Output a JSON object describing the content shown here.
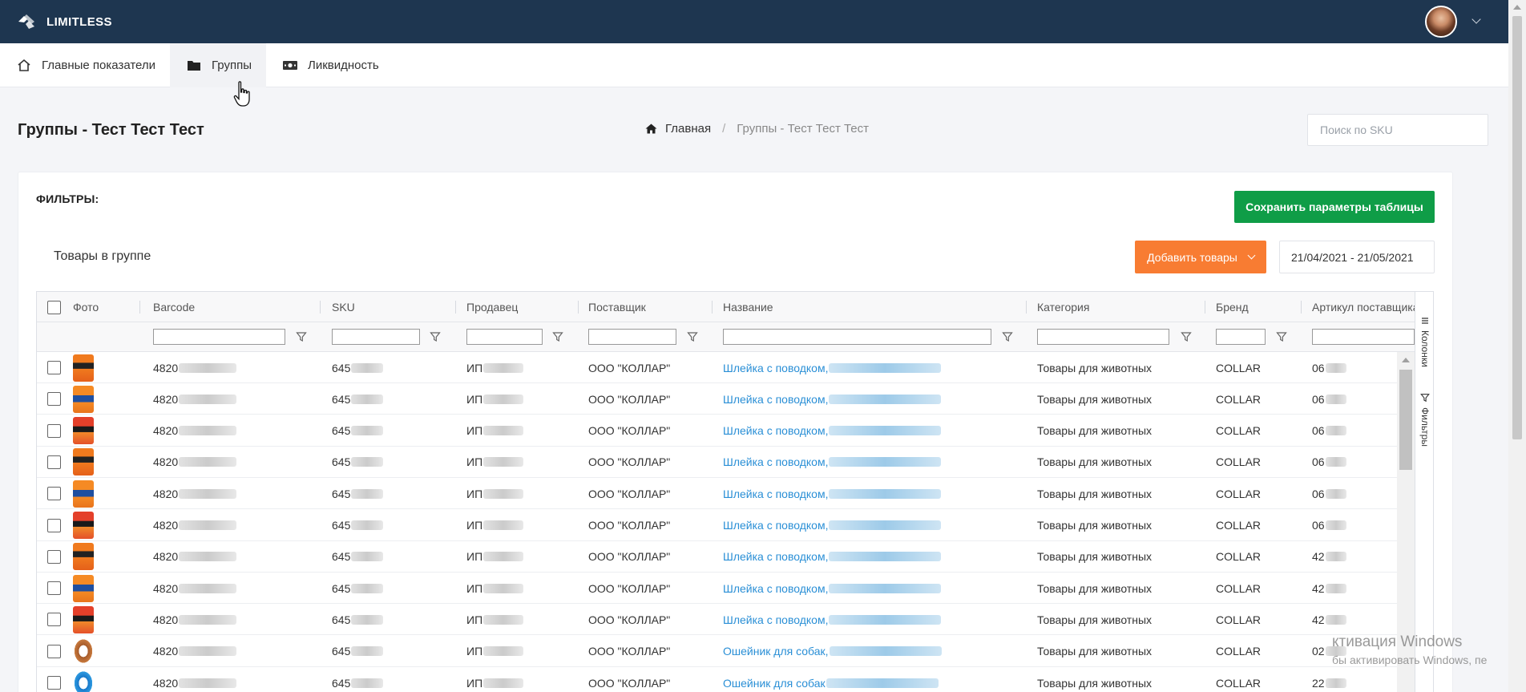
{
  "app": {
    "brand": "LIMITLESS"
  },
  "nav": {
    "items": [
      {
        "label": "Главные показатели",
        "icon": "home-icon"
      },
      {
        "label": "Группы",
        "icon": "folder-icon"
      },
      {
        "label": "Ликвидность",
        "icon": "money-icon"
      }
    ],
    "active": "Группы"
  },
  "page": {
    "title": "Группы - Тест Тест Тест"
  },
  "breadcrumb": {
    "home": "Главная",
    "separator": "/",
    "current": "Группы - Тест Тест Тест"
  },
  "search": {
    "placeholder": "Поиск по SKU",
    "value": ""
  },
  "filters": {
    "label": "ФИЛЬТРЫ:"
  },
  "buttons": {
    "save": "Сохранить параметры таблицы",
    "add": "Добавить товары"
  },
  "group": {
    "label": "Товары в группе"
  },
  "date_range": {
    "value": "21/04/2021 - 21/05/2021"
  },
  "table": {
    "columns": [
      "Фото",
      "Barcode",
      "SKU",
      "Продавец",
      "Поставщик",
      "Название",
      "Категория",
      "Бренд",
      "Артикул поставщика"
    ],
    "side_tabs": [
      "Колонки",
      "Фильтры"
    ],
    "rows": [
      {
        "barcode": "4820",
        "sku": "645",
        "seller": "ИП",
        "supplier": "ООО \"КОЛЛАР\"",
        "name": "Шлейка с поводком,",
        "category": "Товары для животных",
        "brand": "COLLAR",
        "article": "06",
        "thumb": "harness-orange-black"
      },
      {
        "barcode": "4820",
        "sku": "645",
        "seller": "ИП",
        "supplier": "ООО \"КОЛЛАР\"",
        "name": "Шлейка с поводком,",
        "category": "Товары для животных",
        "brand": "COLLAR",
        "article": "06",
        "thumb": "harness-orange-blue"
      },
      {
        "barcode": "4820",
        "sku": "645",
        "seller": "ИП",
        "supplier": "ООО \"КОЛЛАР\"",
        "name": "Шлейка с поводком,",
        "category": "Товары для животных",
        "brand": "COLLAR",
        "article": "06",
        "thumb": "harness-red-black"
      },
      {
        "barcode": "4820",
        "sku": "645",
        "seller": "ИП",
        "supplier": "ООО \"КОЛЛАР\"",
        "name": "Шлейка с поводком,",
        "category": "Товары для животных",
        "brand": "COLLAR",
        "article": "06",
        "thumb": "harness-orange-black"
      },
      {
        "barcode": "4820",
        "sku": "645",
        "seller": "ИП",
        "supplier": "ООО \"КОЛЛАР\"",
        "name": "Шлейка с поводком,",
        "category": "Товары для животных",
        "brand": "COLLAR",
        "article": "06",
        "thumb": "harness-orange-blue"
      },
      {
        "barcode": "4820",
        "sku": "645",
        "seller": "ИП",
        "supplier": "ООО \"КОЛЛАР\"",
        "name": "Шлейка с поводком,",
        "category": "Товары для животных",
        "brand": "COLLAR",
        "article": "06",
        "thumb": "harness-red-black"
      },
      {
        "barcode": "4820",
        "sku": "645",
        "seller": "ИП",
        "supplier": "ООО \"КОЛЛАР\"",
        "name": "Шлейка с поводком,",
        "category": "Товары для животных",
        "brand": "COLLAR",
        "article": "42",
        "thumb": "harness-orange-black"
      },
      {
        "barcode": "4820",
        "sku": "645",
        "seller": "ИП",
        "supplier": "ООО \"КОЛЛАР\"",
        "name": "Шлейка с поводком,",
        "category": "Товары для животных",
        "brand": "COLLAR",
        "article": "42",
        "thumb": "harness-orange-blue"
      },
      {
        "barcode": "4820",
        "sku": "645",
        "seller": "ИП",
        "supplier": "ООО \"КОЛЛАР\"",
        "name": "Шлейка с поводком,",
        "category": "Товары для животных",
        "brand": "COLLAR",
        "article": "42",
        "thumb": "harness-red-black"
      },
      {
        "barcode": "4820",
        "sku": "645",
        "seller": "ИП",
        "supplier": "ООО \"КОЛЛАР\"",
        "name": "Ошейник для собак,",
        "category": "Товары для животных",
        "brand": "COLLAR",
        "article": "02",
        "thumb": "collar-brown"
      },
      {
        "barcode": "4820",
        "sku": "645",
        "seller": "ИП",
        "supplier": "ООО \"КОЛЛАР\"",
        "name": "Ошейник для собак",
        "category": "Товары для животных",
        "brand": "COLLAR",
        "article": "22",
        "thumb": "collar-blue"
      }
    ]
  },
  "os": {
    "activation_title": "ктивация Windows",
    "activation_text": "бы активировать Windows, пе"
  },
  "colors": {
    "topbar": "#1e3650",
    "save": "#0f9d47",
    "add": "#f87c32",
    "link": "#2a8fd6"
  }
}
